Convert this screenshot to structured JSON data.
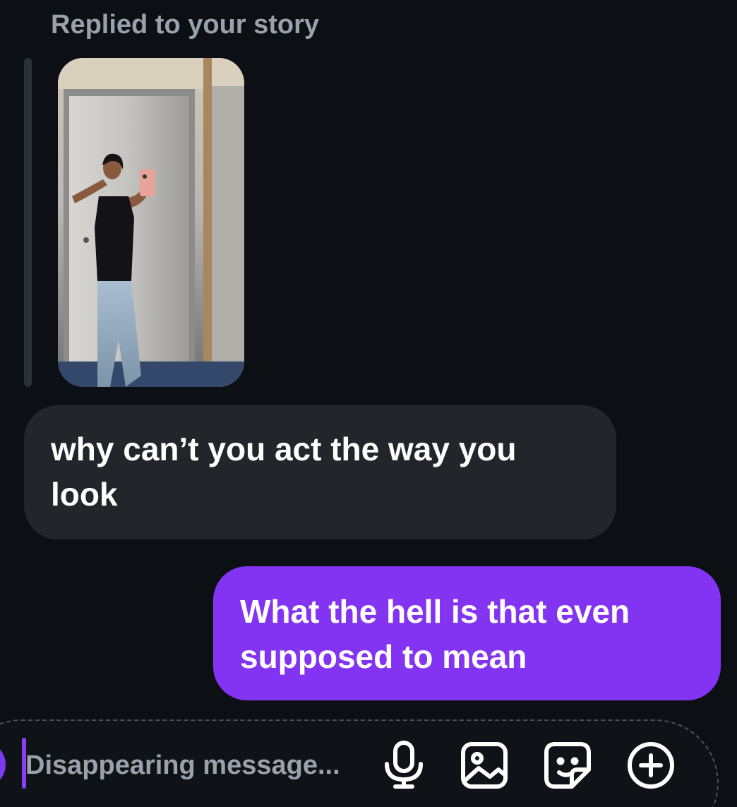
{
  "thread": {
    "story_reply": {
      "header": "Replied to your story",
      "thumbnail_alt": "Story photo"
    },
    "messages": [
      {
        "sender": "them",
        "text": "why can’t you act the way you look"
      },
      {
        "sender": "me",
        "text": "What the hell is that even supposed to mean"
      }
    ]
  },
  "composer": {
    "placeholder": "Disappearing message..."
  },
  "icons": {
    "mic": "microphone-icon",
    "gallery": "image-icon",
    "sticker": "sticker-icon",
    "add": "plus-circle-icon"
  },
  "colors": {
    "background": "#0c0f14",
    "incoming_bubble": "#22262b",
    "outgoing_bubble": "#8334f2",
    "muted_text": "#9aa1ab",
    "accent": "#8a3ff5"
  }
}
